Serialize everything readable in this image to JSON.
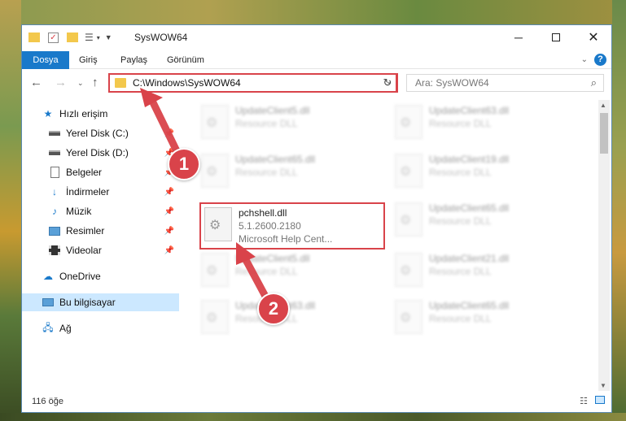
{
  "window": {
    "title": "SysWOW64",
    "minimize_icon": "minimize-icon",
    "maximize_icon": "maximize-icon",
    "close_icon": "close-icon"
  },
  "ribbon": {
    "tabs": [
      {
        "label": "Dosya",
        "active": true
      },
      {
        "label": "Giriş",
        "active": false
      },
      {
        "label": "Paylaş",
        "active": false
      },
      {
        "label": "Görünüm",
        "active": false
      }
    ],
    "help_label": "?"
  },
  "nav": {
    "address": "C:\\Windows\\SysWOW64",
    "search_placeholder": "Ara: SysWOW64"
  },
  "sidebar": {
    "items": [
      {
        "label": "Hızlı erişim",
        "icon": "star-icon",
        "pinned": false,
        "selected": false
      },
      {
        "label": "Yerel Disk (C:)",
        "icon": "drive-icon",
        "pinned": true,
        "selected": false
      },
      {
        "label": "Yerel Disk (D:)",
        "icon": "drive-icon",
        "pinned": true,
        "selected": false
      },
      {
        "label": "Belgeler",
        "icon": "documents-icon",
        "pinned": true,
        "selected": false
      },
      {
        "label": "İndirmeler",
        "icon": "download-icon",
        "pinned": true,
        "selected": false
      },
      {
        "label": "Müzik",
        "icon": "music-icon",
        "pinned": true,
        "selected": false
      },
      {
        "label": "Resimler",
        "icon": "pictures-icon",
        "pinned": true,
        "selected": false
      },
      {
        "label": "Videolar",
        "icon": "videos-icon",
        "pinned": true,
        "selected": false
      },
      {
        "label": "OneDrive",
        "icon": "cloud-icon",
        "pinned": false,
        "selected": false
      },
      {
        "label": "Bu bilgisayar",
        "icon": "computer-icon",
        "pinned": false,
        "selected": true
      },
      {
        "label": "Ağ",
        "icon": "network-icon",
        "pinned": false,
        "selected": false
      }
    ]
  },
  "files": [
    {
      "name": "UpdateClient5.dll",
      "desc": "Resource DLL",
      "highlight": false
    },
    {
      "name": "UpdateClient63.dll",
      "desc": "Resource DLL",
      "highlight": false
    },
    {
      "name": "UpdateClient65.dll",
      "desc": "Resource DLL",
      "highlight": false
    },
    {
      "name": "UpdateClient19.dll",
      "desc": "Resource DLL",
      "highlight": false
    },
    {
      "name": "pchshell.dll",
      "desc": "5.1.2600.2180",
      "desc2": "Microsoft Help Cent...",
      "highlight": true
    },
    {
      "name": "UpdateClient65.dll",
      "desc": "Resource DLL",
      "highlight": false
    },
    {
      "name": "UpdateClient5.dll",
      "desc": "Resource DLL",
      "highlight": false
    },
    {
      "name": "UpdateClient21.dll",
      "desc": "Resource DLL",
      "highlight": false
    },
    {
      "name": "UpdateClient63.dll",
      "desc": "Resource DLL",
      "highlight": false
    },
    {
      "name": "UpdateClient65.dll",
      "desc": "Resource DLL",
      "highlight": false
    }
  ],
  "status": {
    "item_count": "116 öğe"
  },
  "callouts": [
    {
      "number": "1"
    },
    {
      "number": "2"
    }
  ],
  "colors": {
    "accent": "#1979ca",
    "callout": "#d9434a",
    "selected": "#cce8ff"
  }
}
